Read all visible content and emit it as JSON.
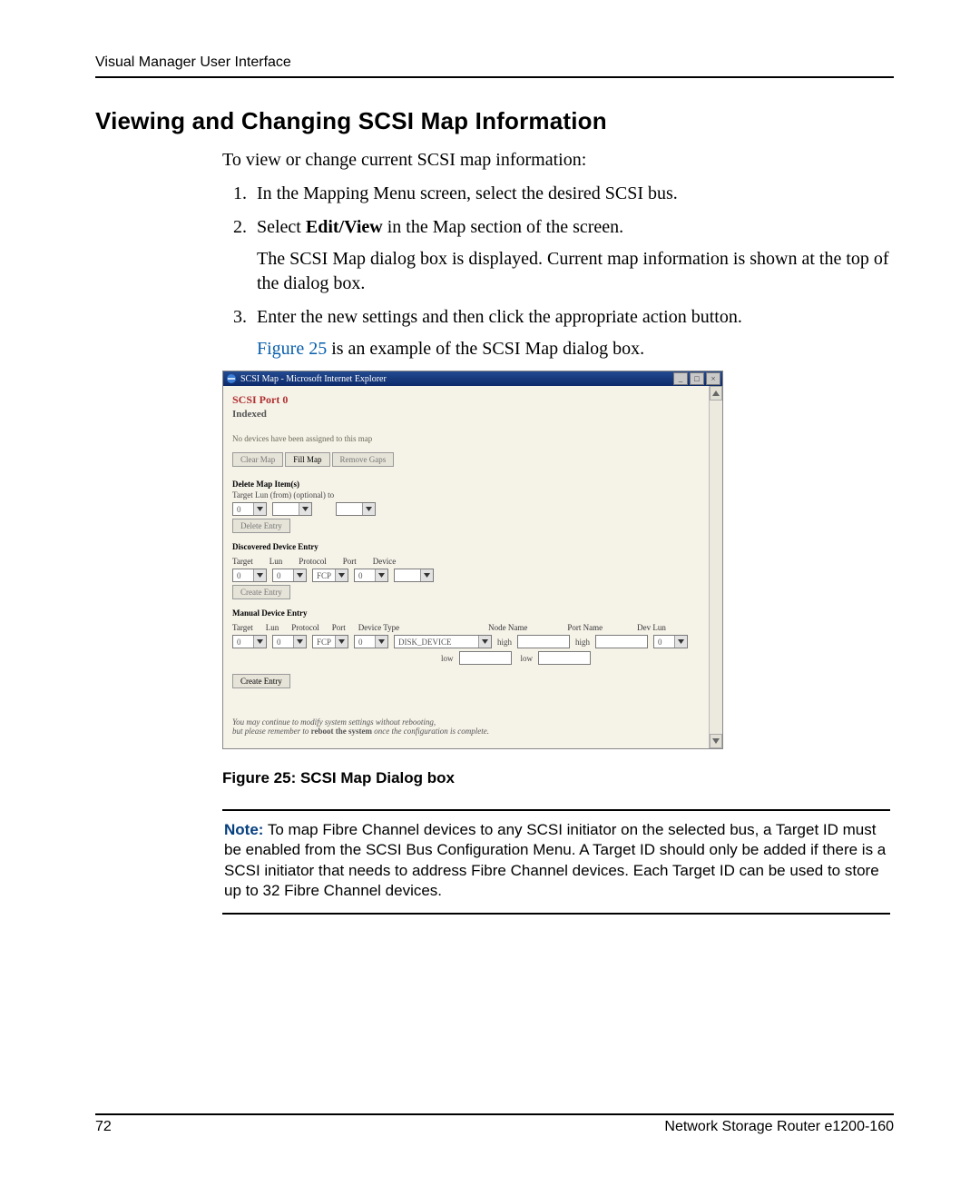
{
  "header": {
    "running": "Visual Manager User Interface"
  },
  "h2": "Viewing and Changing SCSI Map Information",
  "intro": "To view or change current SCSI map information:",
  "steps": {
    "s1": "In the Mapping Menu screen, select the desired SCSI bus.",
    "s2a": "Select ",
    "s2b": "Edit/View",
    "s2c": " in the Map section of the screen.",
    "s2d": "The SCSI Map dialog box is displayed. Current map information is shown at the top of the dialog box.",
    "s3a": "Enter the new settings and then click the appropriate action button.",
    "s3link": "Figure 25",
    "s3b": " is an example of the SCSI Map dialog box."
  },
  "dialog": {
    "title": "SCSI Map - Microsoft Internet Explorer",
    "scsi": "SCSI Port 0",
    "indexed": "Indexed",
    "nodev": "No devices have been assigned to this map",
    "buttons": {
      "clear": "Clear Map",
      "fill": "Fill Map",
      "remove": "Remove Gaps"
    },
    "delete": {
      "hdr": "Delete Map Item(s)",
      "lbl": "Target  Lun (from) (optional) to",
      "btn": "Delete Entry"
    },
    "disc": {
      "hdr": "Discovered Device Entry",
      "cols": {
        "c1": "Target",
        "c2": "Lun",
        "c3": "Protocol",
        "c4": "Port",
        "c5": "Device"
      },
      "sel": {
        "v1": "0",
        "v2": "0",
        "v3": "FCP",
        "v4": "0"
      },
      "btn": "Create Entry"
    },
    "man": {
      "hdr": "Manual Device Entry",
      "cols": {
        "c1": "Target",
        "c2": "Lun",
        "c3": "Protocol",
        "c4": "Port",
        "c5": "Device Type",
        "c6": "Node Name",
        "c7": "Port Name",
        "c8": "Dev Lun"
      },
      "sel": {
        "v1": "0",
        "v2": "0",
        "v3": "FCP",
        "v4": "0",
        "devtype": "DISK_DEVICE",
        "devlun": "0"
      },
      "lbls": {
        "high": "high",
        "low": "low"
      },
      "btn": "Create Entry"
    },
    "foot1": "You may continue to modify system settings without rebooting,",
    "foot2a": "but please remember to ",
    "foot2b": "reboot the system",
    "foot2c": " once the configuration is complete."
  },
  "figcap": "Figure 25:  SCSI Map Dialog box",
  "note": {
    "label": "Note:",
    "text": "  To map Fibre Channel devices to any SCSI initiator on the selected bus, a Target ID must be enabled from the SCSI Bus Configuration Menu. A Target ID should only be added if there is a SCSI initiator that needs to address Fibre Channel devices. Each Target ID can be used to store up to 32 Fibre Channel devices."
  },
  "footer": {
    "page": "72",
    "doc": "Network Storage Router e1200-160"
  }
}
